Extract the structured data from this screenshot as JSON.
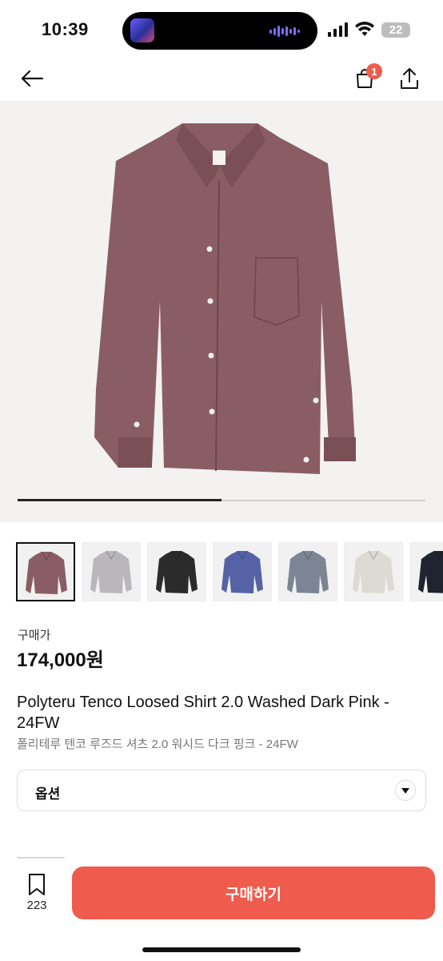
{
  "status": {
    "time": "10:39",
    "battery": "22"
  },
  "nav": {
    "cart_badge": "1"
  },
  "gallery": {
    "progress": 0.5,
    "shirt_color": "#8a5d64"
  },
  "thumbnails": [
    {
      "color": "#8a5d64"
    },
    {
      "color": "#b9b7bb"
    },
    {
      "color": "#2b2b2b"
    },
    {
      "color": "#5563a6"
    },
    {
      "color": "#7d8595"
    },
    {
      "color": "#dcdad3"
    },
    {
      "color": "#1f2430"
    }
  ],
  "product": {
    "price_label": "구매가",
    "price": "174,000원",
    "title": "Polyteru Tenco Loosed Shirt 2.0 Washed Dark Pink - 24FW",
    "subtitle": "폴리테루 텐코 루즈드 셔츠 2.0 워시드 다크 핑크 - 24FW",
    "option_label": "옵션"
  },
  "bottom": {
    "bookmark_count": "223",
    "buy_label": "구매하기"
  },
  "colors": {
    "accent": "#ef5b4c"
  }
}
